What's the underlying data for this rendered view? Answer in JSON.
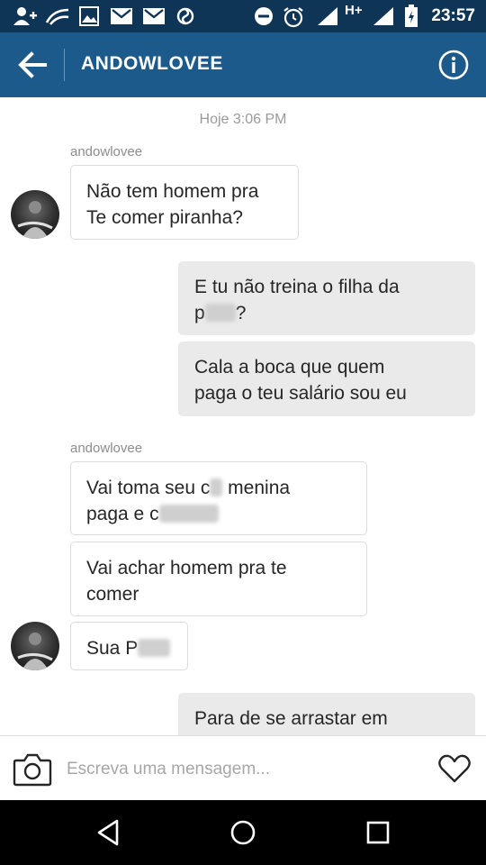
{
  "status_bar": {
    "network": "H+",
    "time": "23:57",
    "icons": [
      "add-person-icon",
      "swipe-icon",
      "image-icon",
      "gmail-icon",
      "gmail-icon",
      "sync-icon",
      "do-not-disturb-icon",
      "alarm-icon",
      "signal-icon",
      "signal-icon",
      "battery-icon"
    ]
  },
  "header": {
    "title": "ANDOWLOVEE",
    "back_icon": "arrow-left-icon",
    "info_icon": "info-icon",
    "bar_color": "#1c5a8b"
  },
  "chat": {
    "timestamp": "Hoje 3:06 PM",
    "sender_name": "andowlovee",
    "messages": [
      {
        "from": "them",
        "text": "Não tem homem pra\nTe comer piranha?"
      },
      {
        "from": "me",
        "text_a": "E tu não treina o filha da\np",
        "text_b": "?"
      },
      {
        "from": "me",
        "text": "Cala a boca que quem\npaga o teu salário sou eu"
      },
      {
        "from": "them",
        "text_a": "Vai toma seu c",
        "text_b": " menina\npaga e c"
      },
      {
        "from": "them",
        "text": "Vai achar homem pra te\ncomer"
      },
      {
        "from": "them",
        "text": "Sua P"
      },
      {
        "from": "me",
        "text": "Para de se arrastar em"
      }
    ]
  },
  "composer": {
    "placeholder": "Escreva uma mensagem...",
    "camera_icon": "camera-icon",
    "like_icon": "heart-icon"
  },
  "nav": {
    "icons": [
      "back-triangle-icon",
      "home-circle-icon",
      "recents-square-icon"
    ]
  }
}
